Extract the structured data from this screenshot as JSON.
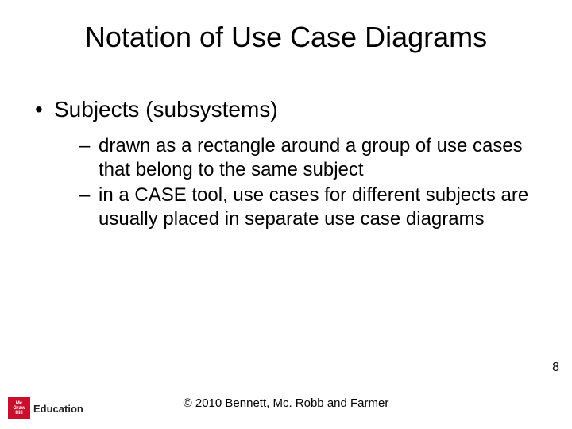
{
  "title": "Notation of Use Case Diagrams",
  "bullets": {
    "lvl1_0": "Subjects (subsystems)",
    "lvl2_0": "drawn as a rectangle around a group of use cases that belong to the same subject",
    "lvl2_1": "in a CASE tool, use cases for different subjects are usually placed in separate use case diagrams"
  },
  "page_number": "8",
  "copyright": "© 2010 Bennett, Mc. Robb and Farmer",
  "logo": {
    "line1": "Mc",
    "line2": "Graw",
    "line3": "Hill",
    "brand": "Education"
  }
}
